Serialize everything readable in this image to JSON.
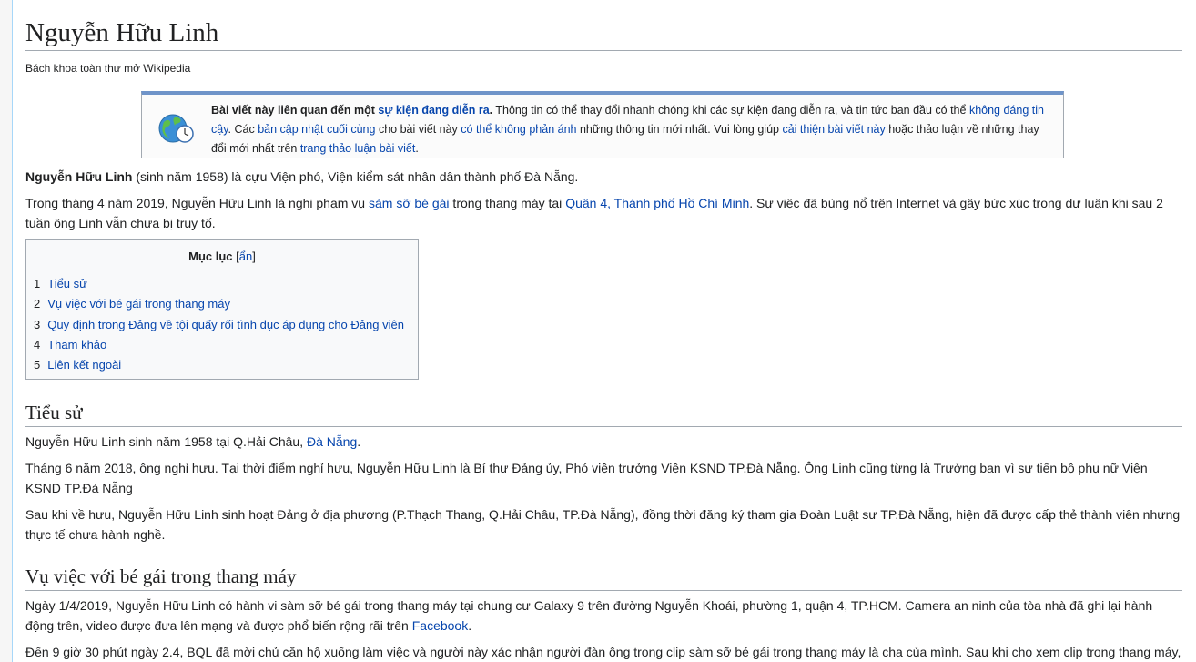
{
  "title": "Nguyễn Hữu Linh",
  "tagline": "Bách khoa toàn thư mở Wikipedia",
  "notice": {
    "bold_prefix": "Bài viết này liên quan đến một ",
    "bold_link": "sự kiện đang diễn ra",
    "bold_suffix": ".",
    "t1": " Thông tin có thể thay đổi nhanh chóng khi các sự kiện đang diễn ra, và tin tức ban đầu có thể ",
    "l1": "không đáng tin cậy",
    "t2": ". Các ",
    "l2": "bản cập nhật cuối cùng",
    "t3": " cho bài viết này ",
    "l3": "có thể không phản ánh",
    "t4": " những thông tin mới nhất. Vui lòng giúp ",
    "l4": "cải thiện bài viết này",
    "t5": " hoặc thảo luận về những thay đổi mới nhất trên ",
    "l5": "trang thảo luận bài viết",
    "t6": "."
  },
  "intro": {
    "p1_bold": "Nguyễn Hữu Linh",
    "p1_rest": " (sinh năm 1958) là cựu Viện phó, Viện kiểm sát nhân dân thành phố Đà Nẵng.",
    "p2_a": "Trong tháng 4 năm 2019, Nguyễn Hữu Linh là nghi phạm vụ ",
    "p2_l1": "sàm sỡ bé gái",
    "p2_b": " trong thang máy tại ",
    "p2_l2": "Quận 4, Thành phố Hồ Chí Minh",
    "p2_c": ". Sự việc đã bùng nổ trên Internet và gây bức xúc trong dư luận khi sau 2 tuần ông Linh vẫn chưa bị truy tố."
  },
  "toc": {
    "title": "Mục lục",
    "toggle_open": "[",
    "toggle": "ẩn",
    "toggle_close": "]",
    "items": [
      {
        "num": "1",
        "label": "Tiểu sử"
      },
      {
        "num": "2",
        "label": "Vụ việc với bé gái trong thang máy"
      },
      {
        "num": "3",
        "label": "Quy định trong Đảng về tội quấy rối tình dục áp dụng cho Đảng viên"
      },
      {
        "num": "4",
        "label": "Tham khảo"
      },
      {
        "num": "5",
        "label": "Liên kết ngoài"
      }
    ]
  },
  "section1": {
    "heading": "Tiểu sử",
    "p1_a": "Nguyễn Hữu Linh sinh năm 1958 tại Q.Hải Châu, ",
    "p1_link": "Đà Nẵng",
    "p1_b": ".",
    "p2": "Tháng 6 năm 2018, ông nghỉ hưu. Tại thời điểm nghỉ hưu, Nguyễn Hữu Linh là Bí thư Đảng ủy, Phó viện trưởng Viện KSND TP.Đà Nẵng. Ông Linh cũng từng là Trưởng ban vì sự tiến bộ phụ nữ Viện KSND TP.Đà Nẵng",
    "p3": "Sau khi về hưu, Nguyễn Hữu Linh sinh hoạt Đảng ở địa phương (P.Thạch Thang, Q.Hải Châu, TP.Đà Nẵng), đồng thời đăng ký tham gia Đoàn Luật sư TP.Đà Nẵng, hiện đã được cấp thẻ thành viên nhưng thực tế chưa hành nghề."
  },
  "section2": {
    "heading": "Vụ việc với bé gái trong thang máy",
    "p1_a": "Ngày 1/4/2019, Nguyễn Hữu Linh có hành vi sàm sỡ bé gái trong thang máy tại chung cư Galaxy 9 trên đường Nguyễn Khoái, phường 1, quận 4, TP.HCM. Camera an ninh của tòa nhà đã ghi lại hành động trên, video được đưa lên mạng và được phổ biến rộng rãi trên ",
    "p1_link": "Facebook",
    "p1_b": ".",
    "p2": "Đến 9 giờ 30 phút ngày 2.4, BQL đã mời chủ căn hộ xuống làm việc và người này xác nhận người đàn ông trong clip sàm sỡ bé gái trong thang máy là cha của mình. Sau khi cho xem clip trong thang máy,"
  }
}
